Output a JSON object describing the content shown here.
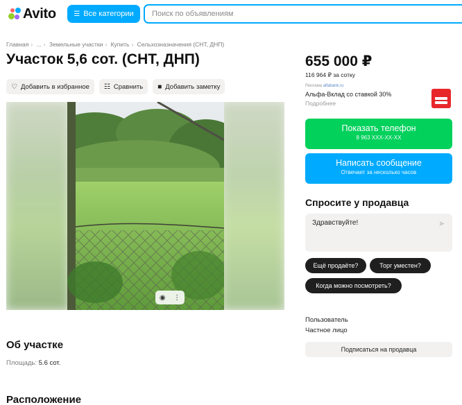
{
  "header": {
    "logo_text": "Avito",
    "categories_button": "Все категории",
    "search_placeholder": "Поиск по объявлениям",
    "accent_color": "#00aaff"
  },
  "breadcrumb": [
    "Главная",
    "...",
    "Земельные участки",
    "Купить",
    "Сельхозназначения (СНТ, ДНП)"
  ],
  "listing": {
    "title": "Участок 5,6 сот. (СНТ, ДНП)",
    "actions": {
      "favorite": "Добавить в избранное",
      "compare": "Сравнить",
      "note": "Добавить заметку"
    },
    "gallery_icons": [
      "camera-icon",
      "more-icon"
    ]
  },
  "sidebar": {
    "price": "655 000 ₽",
    "price_per": "116 964 ₽ за сотку",
    "ad": {
      "tag": "Реклама",
      "domain": "alfabank.ru",
      "title": "Альфа-Вклад со ставкой 30%",
      "more": "Подробнее"
    },
    "phone_button": {
      "label": "Показать телефон",
      "sub": "8 963 XXX-XX-XX",
      "color": "#02d15c"
    },
    "message_button": {
      "label": "Написать сообщение",
      "sub": "Отвечает за несколько часов",
      "color": "#00aaff"
    },
    "ask": {
      "heading": "Спросите у продавца",
      "message": "Здравствуйте!",
      "chips": [
        "Ещё продаёте?",
        "Торг уместен?",
        "Когда можно посмотреть?"
      ]
    },
    "seller": {
      "name": "Пользователь",
      "type": "Частное лицо",
      "subscribe": "Подписаться на продавца"
    }
  },
  "about": {
    "heading": "Об участке",
    "area_label": "Площадь:",
    "area_value": "5.6 сот."
  },
  "location": {
    "heading": "Расположение"
  }
}
